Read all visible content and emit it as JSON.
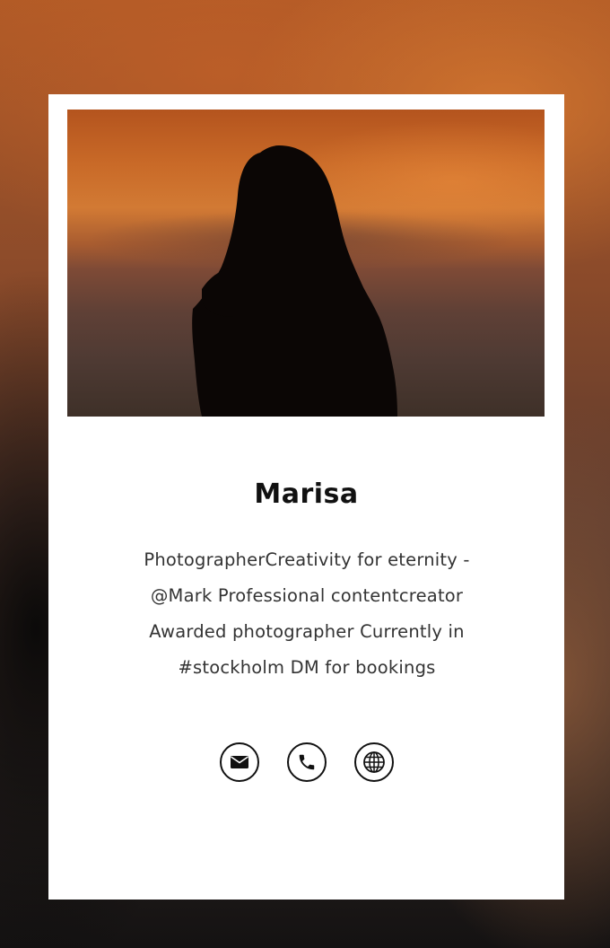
{
  "profile": {
    "name": "Marisa",
    "bio": "PhotographerCreativity for eternity - @Mark Professional contentcreator Awarded photographer Currently in #stockholm DM for bookings"
  },
  "contacts": [
    {
      "type": "email",
      "icon": "envelope-icon"
    },
    {
      "type": "phone",
      "icon": "phone-icon"
    },
    {
      "type": "website",
      "icon": "globe-icon"
    }
  ],
  "colors": {
    "card": "#ffffff",
    "text_primary": "#111111",
    "text_secondary": "#333333",
    "sunset_orange": "#d27a34"
  }
}
